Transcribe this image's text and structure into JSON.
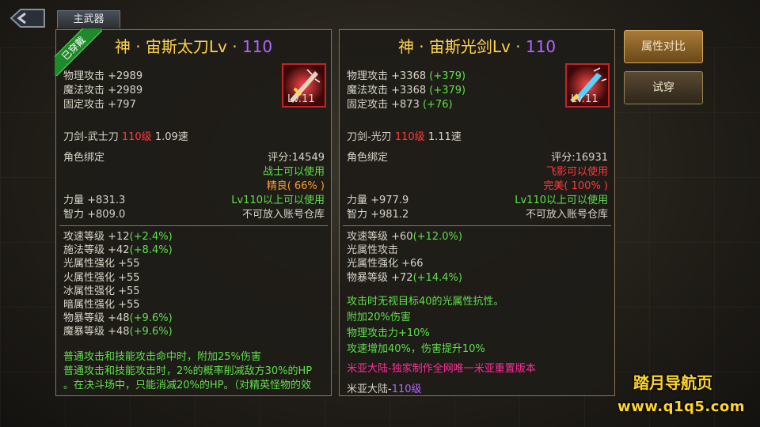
{
  "tab": {
    "label": "主武器"
  },
  "buttons": {
    "compare": "属性对比",
    "try_on": "试穿"
  },
  "watermark": {
    "name": "踏月导航页",
    "url": "www.q1q5.com"
  },
  "colors": {
    "title": "#ffd24a",
    "level": "#b065ff",
    "green": "#5ee04a",
    "red": "#ff3a3a",
    "orange": "#ff9a2a",
    "pink": "#ff2e9a",
    "border": "#8a7550"
  },
  "left": {
    "badge": "已穿戴",
    "title": "神 · 宙斯太刀Lv · ",
    "level": "110",
    "icon": "sword-icon",
    "icon_level": "Lv.11",
    "phys_atk": "物理攻击 +2989",
    "mag_atk": "魔法攻击 +2989",
    "fixed_atk": "固定攻击 +797",
    "type": "刀剑-武士刀",
    "type_level": "110级",
    "speed": "1.09速",
    "bind": "角色绑定",
    "score": "评分:14549",
    "usable": "战士可以使用",
    "quality": "精良( 66% )",
    "str": "力量 +831.3",
    "req": "Lv110以上可以使用",
    "int": "智力 +809.0",
    "storage": "不可放入账号仓库",
    "attrs": [
      {
        "t": "攻速等级 +12",
        "g": "(+2.4%)"
      },
      {
        "t": "施法等级 +42",
        "g": "(+8.4%)"
      },
      {
        "t": "光属性强化 +55",
        "g": ""
      },
      {
        "t": "火属性强化 +55",
        "g": ""
      },
      {
        "t": "冰属性强化 +55",
        "g": ""
      },
      {
        "t": "暗属性强化 +55",
        "g": ""
      },
      {
        "t": "物暴等级 +48",
        "g": "(+9.6%)"
      },
      {
        "t": "魔暴等级 +48",
        "g": "(+9.6%)"
      }
    ],
    "effects": [
      "普通攻击和技能攻击命中时，附加25%伤害",
      "普通攻击和技能攻击时，2%的概率削减敌方30%的HP",
      "。在决斗场中，只能消减20%的HP。（对精英怪物的效"
    ]
  },
  "right": {
    "title": "神 · 宙斯光剑Lv · ",
    "level": "110",
    "icon": "lightsaber-icon",
    "icon_level": "Lv.11",
    "phys_atk": "物理攻击 +3368",
    "phys_atk_diff": "(+379)",
    "mag_atk": "魔法攻击 +3368",
    "mag_atk_diff": "(+379)",
    "fixed_atk": "固定攻击 +873",
    "fixed_atk_diff": "(+76)",
    "type": "刀剑-光刃",
    "type_level": "110级",
    "speed": "1.11速",
    "bind": "角色绑定",
    "score": "评分:16931",
    "usable": "飞影可以使用",
    "quality": "完美( 100% )",
    "str": "力量 +977.9",
    "req": "Lv110以上可以使用",
    "int": "智力 +981.2",
    "storage": "不可放入账号仓库",
    "attrs": [
      {
        "t": "攻速等级 +60",
        "g": "(+12.0%)"
      },
      {
        "t": "光属性攻击",
        "g": ""
      },
      {
        "t": "光属性强化 +66",
        "g": ""
      },
      {
        "t": "物暴等级 +72",
        "g": "(+14.4%)"
      }
    ],
    "effects": [
      "攻击时无视目标40的光属性抗性。",
      "附加20%伤害",
      "物理攻击力+10%",
      "攻速增加40%，伤害提升10%"
    ],
    "server_note": "米亚大陆-独家制作全网唯一米亚重置版本",
    "footer_name": "米亚大陆-",
    "footer_level": "110级"
  }
}
